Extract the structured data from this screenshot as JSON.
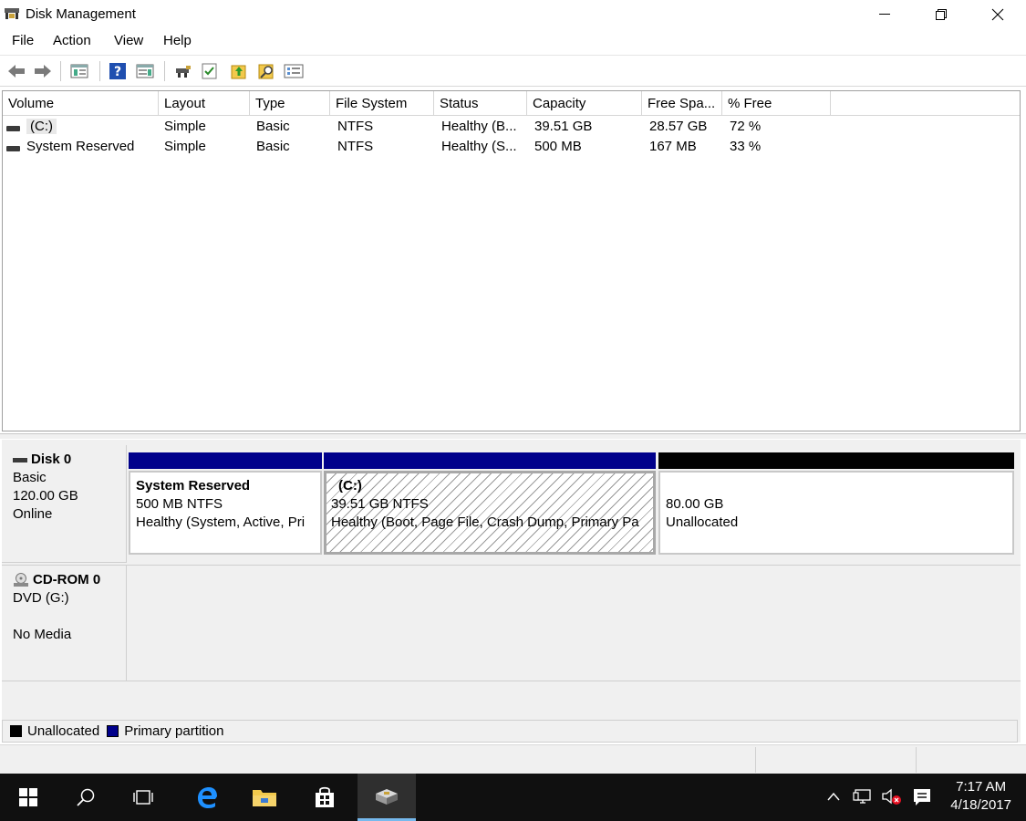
{
  "window": {
    "title": "Disk Management"
  },
  "menu": [
    "File",
    "Action",
    "View",
    "Help"
  ],
  "toolbar": {
    "buttons": [
      "back-icon",
      "forward-icon",
      "console-tree-icon",
      "help-icon",
      "action-pane-icon",
      "connect-icon",
      "check-icon",
      "rescan-icon",
      "search-icon",
      "properties-icon"
    ]
  },
  "volumes": {
    "columns": [
      "Volume",
      "Layout",
      "Type",
      "File System",
      "Status",
      "Capacity",
      "Free Spa...",
      "% Free"
    ],
    "rows": [
      [
        "(C:)",
        "Simple",
        "Basic",
        "NTFS",
        "Healthy (B...",
        "39.51 GB",
        "28.57 GB",
        "72 %"
      ],
      [
        "System Reserved",
        "Simple",
        "Basic",
        "NTFS",
        "Healthy (S...",
        "500 MB",
        "167 MB",
        "33 %"
      ]
    ]
  },
  "disk0": {
    "name": "Disk 0",
    "type": "Basic",
    "size": "120.00 GB",
    "state": "Online",
    "partitions": [
      {
        "name": "System Reserved",
        "size": "500 MB NTFS",
        "status": "Healthy (System, Active, Pri",
        "bar_color": "#00008b"
      },
      {
        "name": "(C:)",
        "size": "39.51 GB NTFS",
        "status": "Healthy (Boot, Page File, Crash Dump, Primary Pa",
        "bar_color": "#00008b"
      },
      {
        "size": "80.00 GB",
        "status": "Unallocated",
        "bar_color": "#000000"
      }
    ]
  },
  "cdrom0": {
    "name": "CD-ROM 0",
    "type": "DVD (G:)",
    "media": "No Media"
  },
  "legend": [
    {
      "label": "Unallocated",
      "color": "#000000"
    },
    {
      "label": "Primary partition",
      "color": "#00008b"
    }
  ],
  "taskbar": {
    "time": "7:17 AM",
    "date": "4/18/2017",
    "items": [
      "windows-start-icon",
      "search-icon",
      "task-view-icon",
      "edge-icon",
      "file-explorer-icon",
      "store-icon",
      "disk-management-icon"
    ]
  }
}
